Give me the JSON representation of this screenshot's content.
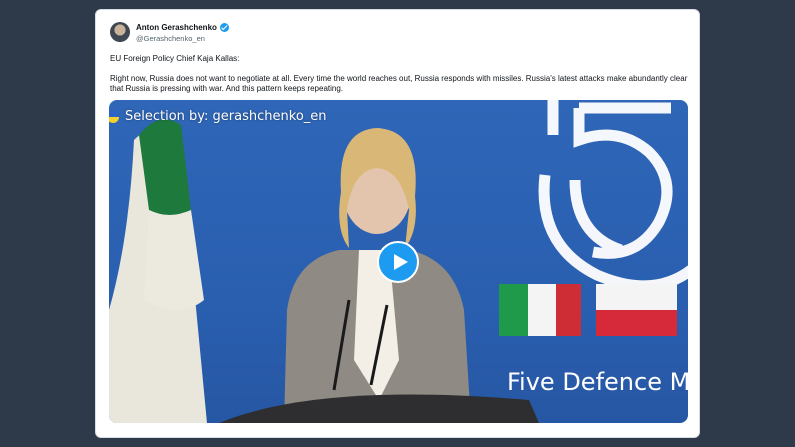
{
  "tweet": {
    "author_name": "Anton Gerashchenko",
    "author_handle": "@Gerashchenko_en",
    "paragraphs": [
      "EU Foreign Policy Chief Kaja Kallas:",
      "Right now, Russia does not want to negotiate at all. Every time the world reaches out, Russia responds with missiles. Russia's latest attacks make abundantly clear that Russia is pressing with war. And this pattern keeps repeating."
    ]
  },
  "media": {
    "overlay_label": "Selection by: gerashchenko_en",
    "backdrop_text": "Five Defence Mi",
    "play_icon": "play-icon"
  },
  "colors": {
    "page_background": "#2e3a4a",
    "card_background": "#ffffff",
    "verified_blue": "#1d9bf0",
    "backdrop_blue": "#2a5fb0"
  }
}
